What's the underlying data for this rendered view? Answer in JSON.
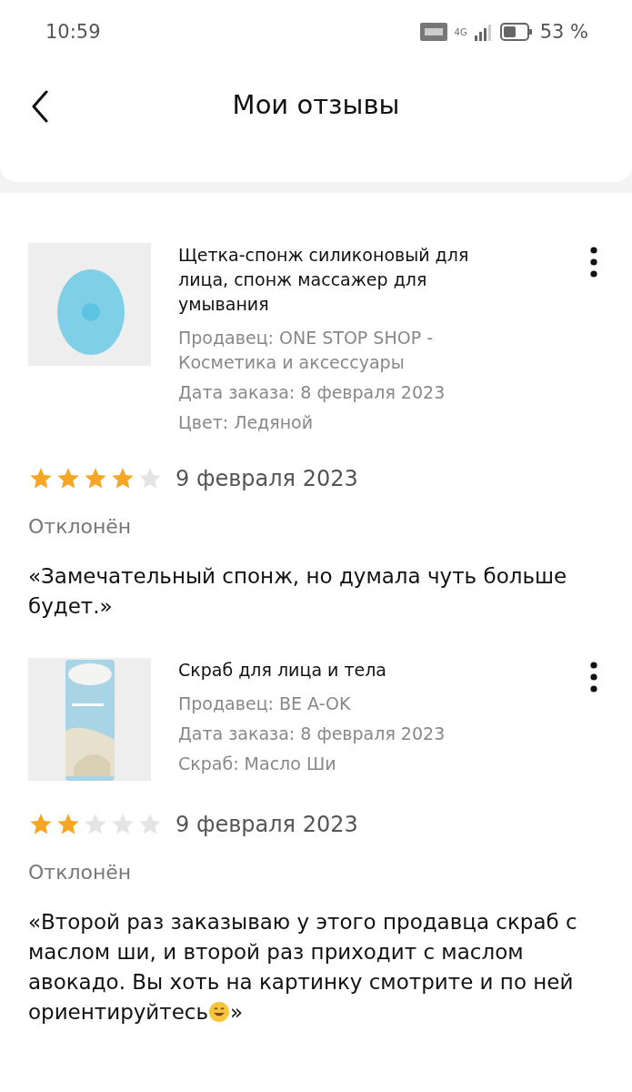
{
  "status_bar": {
    "time": "10:59",
    "network": "4G",
    "battery_text": "53 %"
  },
  "header": {
    "title": "Мои отзывы"
  },
  "reviews": [
    {
      "product": {
        "name": "Щетка-спонж силиконовый для лица, спонж массажер для умывания",
        "seller": "Продавец: ONE STOP SHOP - Косметика и аксессуары",
        "order_date": "Дата заказа: 8 февраля 2023",
        "variant": "Цвет: Ледяной",
        "kind": "sponge"
      },
      "stars": 4,
      "date": "9 февраля 2023",
      "status": "Отклонён",
      "text": "«Замечательный спонж, но думала чуть больше будет.»",
      "emoji": false
    },
    {
      "product": {
        "name": "Скраб для лица и тела",
        "seller": "Продавец: BE A-OK",
        "order_date": "Дата заказа: 8 февраля 2023",
        "variant": "Скраб: Масло Ши",
        "kind": "tube"
      },
      "stars": 2,
      "date": "9 февраля 2023",
      "status": "Отклонён",
      "text": "«Второй раз заказываю у этого продавца скраб с маслом ши, и второй раз приходит с маслом авокадо. Вы хоть на картинку смотрите и по ней ориентируйтесь",
      "text_end": "»",
      "emoji": true
    }
  ]
}
